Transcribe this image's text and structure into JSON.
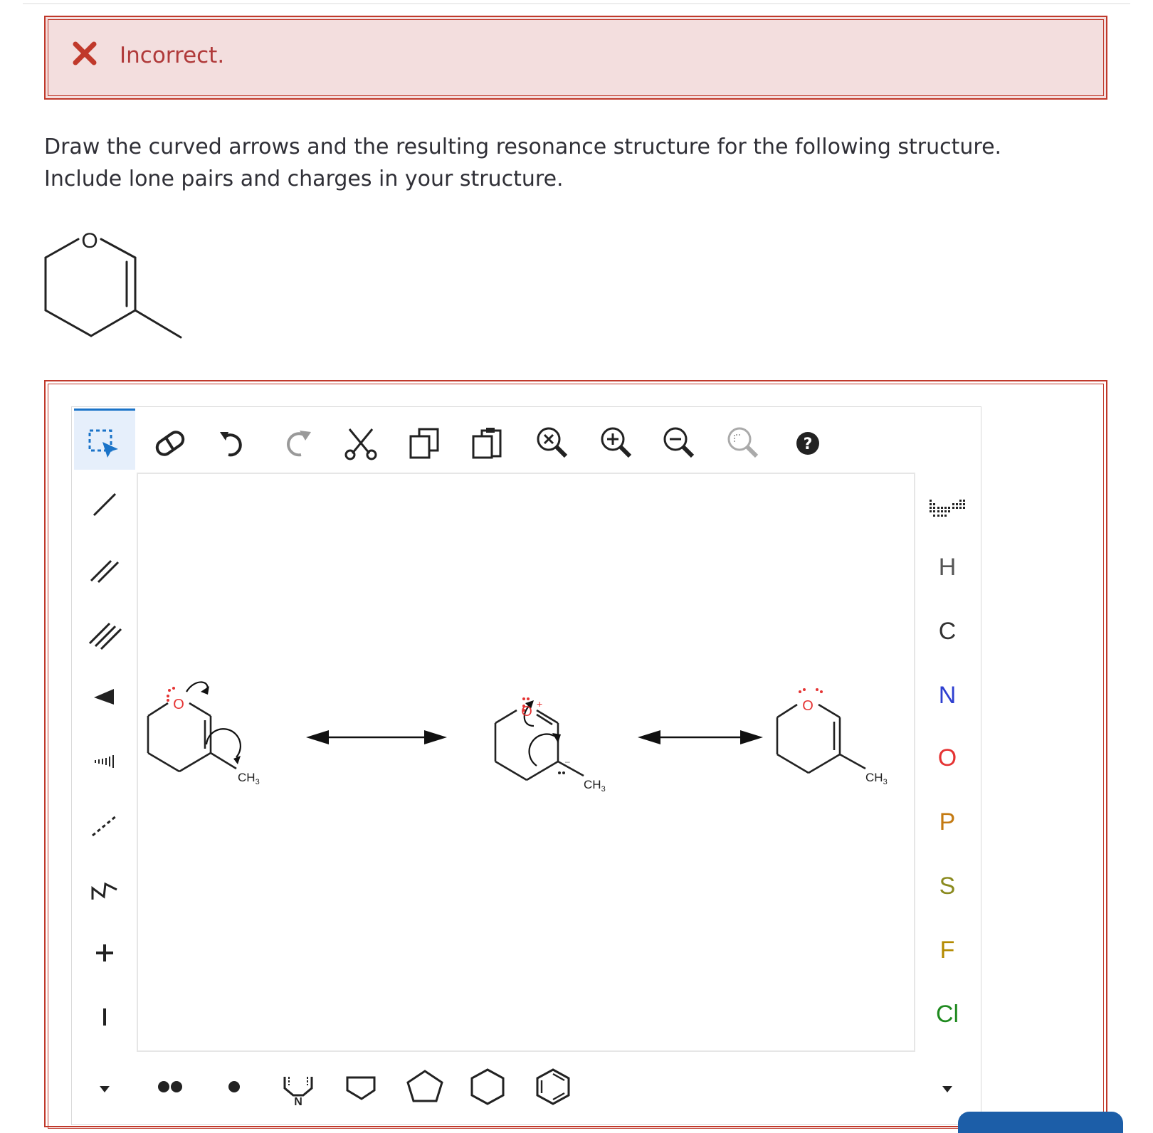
{
  "alert": {
    "icon": "close-x-icon",
    "message": "Incorrect.",
    "color": "#b03a3a",
    "background": "#f3dede"
  },
  "question": {
    "text": "Draw the curved arrows and the resulting resonance structure for the following structure. Include lone pairs and charges in your structure."
  },
  "given_structure": {
    "atom_label": "O"
  },
  "toolbar": {
    "top": [
      "select-icon",
      "eraser-icon",
      "undo-icon",
      "redo-icon",
      "cut-icon",
      "copy-icon",
      "paste-icon",
      "zoom-reset-icon",
      "zoom-in-icon",
      "zoom-out-icon",
      "zoom-fit-icon",
      "help-icon"
    ],
    "left": [
      "single-bond-icon",
      "double-bond-icon",
      "triple-bond-icon",
      "wedge-bond-icon",
      "hash-bond-icon",
      "dashed-bond-icon",
      "chain-icon",
      "plus-charge-icon",
      "minus-charge-icon",
      "more-arrow-icon"
    ],
    "bottom": [
      "lone-pair-icon",
      "radical-icon",
      "template-n-icon",
      "cyclobutane-icon",
      "cyclopentane-icon",
      "cyclohexane-icon",
      "benzene-icon"
    ],
    "template_label": "N"
  },
  "elements": [
    {
      "symbol": "H",
      "color": "#555555"
    },
    {
      "symbol": "C",
      "color": "#333333"
    },
    {
      "symbol": "N",
      "color": "#2e3fd0"
    },
    {
      "symbol": "O",
      "color": "#e53333"
    },
    {
      "symbol": "P",
      "color": "#c47a12"
    },
    {
      "symbol": "S",
      "color": "#8a8a1e"
    },
    {
      "symbol": "F",
      "color": "#b38a00"
    },
    {
      "symbol": "Cl",
      "color": "#1f8a1f"
    }
  ],
  "canvas": {
    "structures": [
      {
        "o_label": "O",
        "ch3_label": "CH",
        "ch3_sub": "3"
      },
      {
        "o_label": "O",
        "charge": "+",
        "ch3_label": "CH",
        "ch3_sub": "3",
        "minus": "–"
      },
      {
        "o_label": "O",
        "ch3_label": "CH",
        "ch3_sub": "3"
      }
    ]
  }
}
